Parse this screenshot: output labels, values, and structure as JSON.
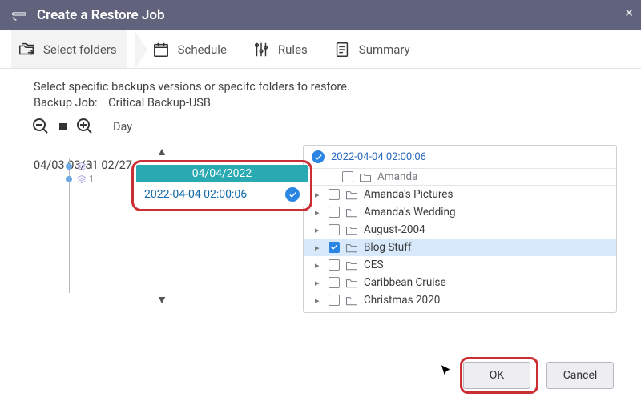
{
  "titlebar": {
    "title": "Create a Restore Job"
  },
  "steps": {
    "select_folders": "Select folders",
    "schedule": "Schedule",
    "rules": "Rules",
    "summary": "Summary"
  },
  "content": {
    "instruction": "Select specific backups versions or specifc folders to restore.",
    "job_label": "Backup Job:",
    "job_value": "Critical Backup-USB",
    "zoom_unit": "Day"
  },
  "timeline": {
    "ticks": [
      "04/03",
      "03/31",
      "02/27"
    ],
    "point_count": "1",
    "snapshot_date": "04/04/2022",
    "snapshot_time": "2022-04-04 02:00:06"
  },
  "tree": {
    "header_time": "2022-04-04 02:00:06",
    "top_hidden": "Amanda",
    "items": [
      {
        "label": "Amanda's Pictures",
        "checked": false,
        "selected": false
      },
      {
        "label": "Amanda's Wedding",
        "checked": false,
        "selected": false
      },
      {
        "label": "August-2004",
        "checked": false,
        "selected": false
      },
      {
        "label": "Blog Stuff",
        "checked": true,
        "selected": true
      },
      {
        "label": "CES",
        "checked": false,
        "selected": false
      },
      {
        "label": "Caribbean Cruise",
        "checked": false,
        "selected": false
      },
      {
        "label": "Christmas 2020",
        "checked": false,
        "selected": false
      }
    ]
  },
  "footer": {
    "ok": "OK",
    "cancel": "Cancel"
  }
}
